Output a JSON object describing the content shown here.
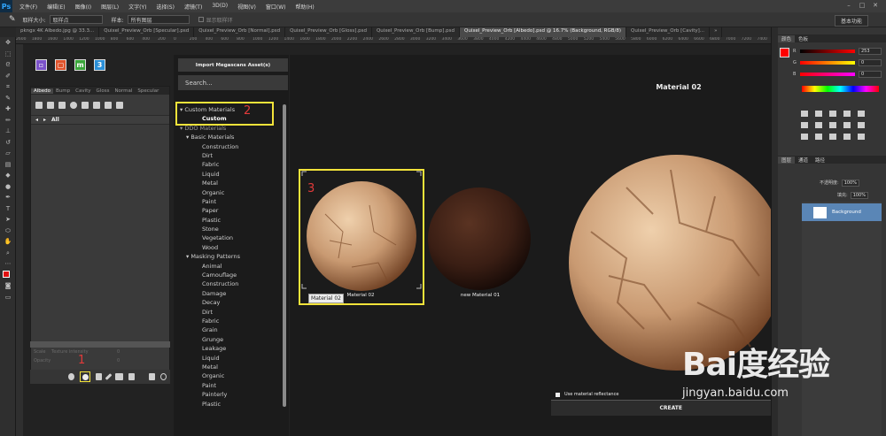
{
  "app": {
    "logo": "Ps",
    "menus": [
      "文件(F)",
      "编辑(E)",
      "图像(I)",
      "图层(L)",
      "文字(Y)",
      "选择(S)",
      "滤镜(T)",
      "3D(D)",
      "视图(V)",
      "窗口(W)",
      "帮助(H)"
    ],
    "window_buttons": [
      "–",
      "□",
      "✕"
    ]
  },
  "options_bar": {
    "size_label": "取样大小:",
    "size_value": "取样点",
    "sample_label": "样本:",
    "sample_value": "所有图层",
    "show_ring_label": "显示取样环",
    "workspace": "基本功能"
  },
  "doc_tabs": [
    "pkngx 4K Albedo.jpg @ 33.3...",
    "Quixel_Preview_Orb [Specular].psd",
    "Quixel_Preview_Orb [Normal].psd",
    "Quixel_Preview_Orb [Gloss].psd",
    "Quixel_Preview_Orb [Bump].psd",
    "Quixel_Preview_Orb [Albedo].psd @ 16.7% (Background, RGB/8)",
    "Quixel_Preview_Orb [Cavity]...",
    "»"
  ],
  "active_tab_index": 5,
  "ruler_ticks": [
    "2600",
    "1800",
    "1600",
    "1400",
    "1200",
    "1000",
    "800",
    "600",
    "400",
    "200",
    "0",
    "200",
    "400",
    "600",
    "800",
    "1000",
    "1200",
    "1400",
    "1600",
    "1800",
    "2000",
    "2200",
    "2400",
    "2600",
    "2800",
    "3000",
    "3200",
    "3400",
    "3600",
    "3800",
    "4000",
    "4200",
    "4400",
    "4600",
    "4800",
    "5000",
    "5200",
    "5400",
    "5600",
    "5800",
    "6000",
    "6200",
    "6400",
    "6600",
    "6800",
    "7000",
    "7200",
    "7400"
  ],
  "ddo": {
    "channel_tabs": [
      "Albedo",
      "Bump",
      "Cavity",
      "Gloss",
      "Normal",
      "Specular"
    ],
    "all_label": "All",
    "sliders": [
      "Scale",
      "Texture intensity",
      "Opacity"
    ],
    "slider_values": [
      "0",
      "0",
      "0"
    ],
    "annotation_1": "1"
  },
  "library": {
    "import_button": "Import Megascans Asset(s)",
    "search_placeholder": "Search...",
    "annotation_2": "2",
    "tree": [
      {
        "label": "▾ Custom Materials",
        "level": 0,
        "style": ""
      },
      {
        "label": "Custom",
        "level": 2,
        "style": "sel"
      },
      {
        "label": "▾ DDO Materials",
        "level": 0,
        "style": "dim"
      },
      {
        "label": "▾ Basic Materials",
        "level": 1,
        "style": ""
      },
      {
        "label": "Construction",
        "level": 2,
        "style": ""
      },
      {
        "label": "Dirt",
        "level": 2,
        "style": ""
      },
      {
        "label": "Fabric",
        "level": 2,
        "style": ""
      },
      {
        "label": "Liquid",
        "level": 2,
        "style": ""
      },
      {
        "label": "Metal",
        "level": 2,
        "style": ""
      },
      {
        "label": "Organic",
        "level": 2,
        "style": ""
      },
      {
        "label": "Paint",
        "level": 2,
        "style": ""
      },
      {
        "label": "Paper",
        "level": 2,
        "style": ""
      },
      {
        "label": "Plastic",
        "level": 2,
        "style": ""
      },
      {
        "label": "Stone",
        "level": 2,
        "style": ""
      },
      {
        "label": "Vegetation",
        "level": 2,
        "style": ""
      },
      {
        "label": "Wood",
        "level": 2,
        "style": ""
      },
      {
        "label": "▾ Masking Patterns",
        "level": 1,
        "style": ""
      },
      {
        "label": "Animal",
        "level": 2,
        "style": ""
      },
      {
        "label": "Camouflage",
        "level": 2,
        "style": ""
      },
      {
        "label": "Construction",
        "level": 2,
        "style": ""
      },
      {
        "label": "Damage",
        "level": 2,
        "style": ""
      },
      {
        "label": "Decay",
        "level": 2,
        "style": ""
      },
      {
        "label": "Dirt",
        "level": 2,
        "style": ""
      },
      {
        "label": "Fabric",
        "level": 2,
        "style": ""
      },
      {
        "label": "Grain",
        "level": 2,
        "style": ""
      },
      {
        "label": "Grunge",
        "level": 2,
        "style": ""
      },
      {
        "label": "Leakage",
        "level": 2,
        "style": ""
      },
      {
        "label": "Liquid",
        "level": 2,
        "style": ""
      },
      {
        "label": "Metal",
        "level": 2,
        "style": ""
      },
      {
        "label": "Organic",
        "level": 2,
        "style": ""
      },
      {
        "label": "Paint",
        "level": 2,
        "style": ""
      },
      {
        "label": "Painterly",
        "level": 2,
        "style": ""
      },
      {
        "label": "Plastic",
        "level": 2,
        "style": ""
      }
    ]
  },
  "preview": {
    "title": "Material 02",
    "annotation_3": "3",
    "thumb1_name_box": "Material 02",
    "thumb1_label": "Material 02",
    "thumb2_label": "new Material 01",
    "reflectance_label": "Use material reflectance",
    "create_button": "CREATE"
  },
  "right": {
    "color_tabs": [
      "颜色",
      "色板"
    ],
    "rows": [
      {
        "lbl": "R",
        "val": "253",
        "grad": "linear-gradient(to right,#000,#f00)"
      },
      {
        "lbl": "G",
        "val": "0",
        "grad": "linear-gradient(to right,#f00,#ff0)"
      },
      {
        "lbl": "B",
        "val": "0",
        "grad": "linear-gradient(to right,#f00,#f0f)"
      }
    ],
    "layers_tabs": [
      "图层",
      "通道",
      "路径"
    ],
    "opacity_label": "不透明度:",
    "opacity_value": "100%",
    "fill_label": "填充:",
    "fill_value": "100%",
    "layer_name": "Background"
  },
  "watermark": {
    "logo": "Bai度经验",
    "url": "jingyan.baidu.com"
  },
  "colors": {
    "accent_yellow": "#f3e33a",
    "annotation_red": "#e23a3a",
    "layer_selected": "#5a86b6"
  }
}
